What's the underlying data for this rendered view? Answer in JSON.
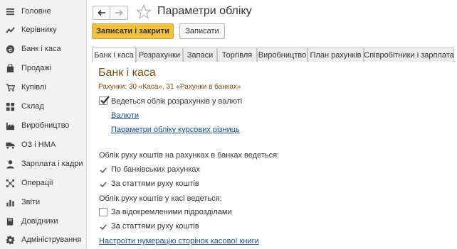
{
  "sidebar": {
    "items": [
      {
        "label": "Головне",
        "icon": "menu-icon"
      },
      {
        "label": "Керівнику",
        "icon": "chart-line-icon"
      },
      {
        "label": "Банк і каса",
        "icon": "money-icon"
      },
      {
        "label": "Продажі",
        "icon": "shopping-bag-icon"
      },
      {
        "label": "Купівлі",
        "icon": "cart-icon"
      },
      {
        "label": "Склад",
        "icon": "warehouse-icon"
      },
      {
        "label": "Виробництво",
        "icon": "factory-icon"
      },
      {
        "label": "ОЗ і НМА",
        "icon": "truck-icon"
      },
      {
        "label": "Зарплата і кадри",
        "icon": "person-icon"
      },
      {
        "label": "Операції",
        "icon": "operations-icon"
      },
      {
        "label": "Звіти",
        "icon": "bar-chart-icon"
      },
      {
        "label": "Довідники",
        "icon": "book-icon"
      },
      {
        "label": "Адміністрування",
        "icon": "gear-icon"
      }
    ]
  },
  "header": {
    "title": "Параметри обліку",
    "save_close_label": "Записати і закрити",
    "save_label": "Записати"
  },
  "tabs": [
    {
      "label": "Банк і каса",
      "active": true
    },
    {
      "label": "Розрахунки",
      "active": false
    },
    {
      "label": "Запаси",
      "active": false
    },
    {
      "label": "Торгівля",
      "active": false
    },
    {
      "label": "Виробництво",
      "active": false
    },
    {
      "label": "План рахунків",
      "active": false
    },
    {
      "label": "Співробітники і зарплата",
      "active": false
    }
  ],
  "panel": {
    "section_title": "Банк і каса",
    "accounts_line": "Рахунки: 30 «Каса», 31 «Рахунки в банках»",
    "currency_checkbox": {
      "label": "Ведеться облік розрахунків у валюті",
      "checked": true
    },
    "currencies_link": "Валюти",
    "exchange_diff_link": "Параметри обліку курсових різниць",
    "bank_heading": "Облік руху коштів на рахунках в банках ведеться:",
    "bank_options": [
      {
        "label": "По банківських рахунках",
        "checked": true
      },
      {
        "label": "За статтями руху коштів",
        "checked": true
      }
    ],
    "cash_heading": "Облік руху коштів у касі ведеться:",
    "cash_options": [
      {
        "label": "За відокремленими підрозділами",
        "checked": false
      },
      {
        "label": "За статтями руху коштів",
        "checked": true
      }
    ],
    "cashbook_link": "Настроїти нумерацію сторінок касової книги"
  },
  "colors": {
    "accent_button": "#f3c23d",
    "section_title": "#7b4d10",
    "link": "#1a4ea2"
  }
}
